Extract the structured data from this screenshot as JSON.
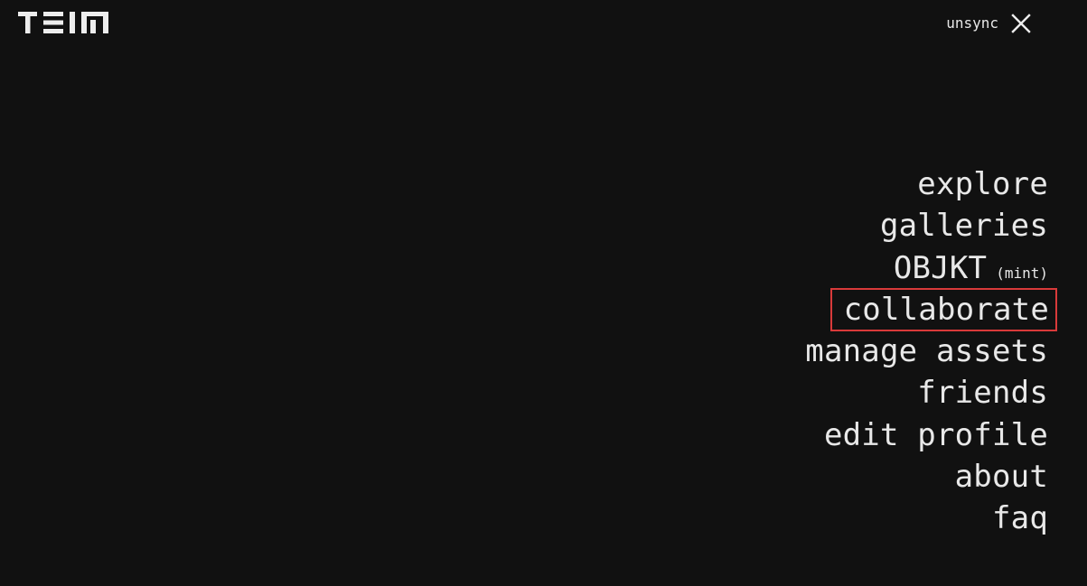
{
  "header": {
    "logo_text": "TEIA",
    "unsync_label": "unsync",
    "close_icon": "close-icon"
  },
  "menu": {
    "items": [
      {
        "label": "explore"
      },
      {
        "label": "galleries"
      },
      {
        "label": "OBJKT",
        "suffix": "(mint)"
      },
      {
        "label": "collaborate",
        "highlighted": true
      },
      {
        "label": "manage assets"
      },
      {
        "label": "friends"
      },
      {
        "label": "edit profile"
      },
      {
        "label": "about"
      },
      {
        "label": "faq"
      }
    ]
  },
  "colors": {
    "background": "#111111",
    "text": "#e8e8e8",
    "highlight_border": "#d93a3a"
  }
}
